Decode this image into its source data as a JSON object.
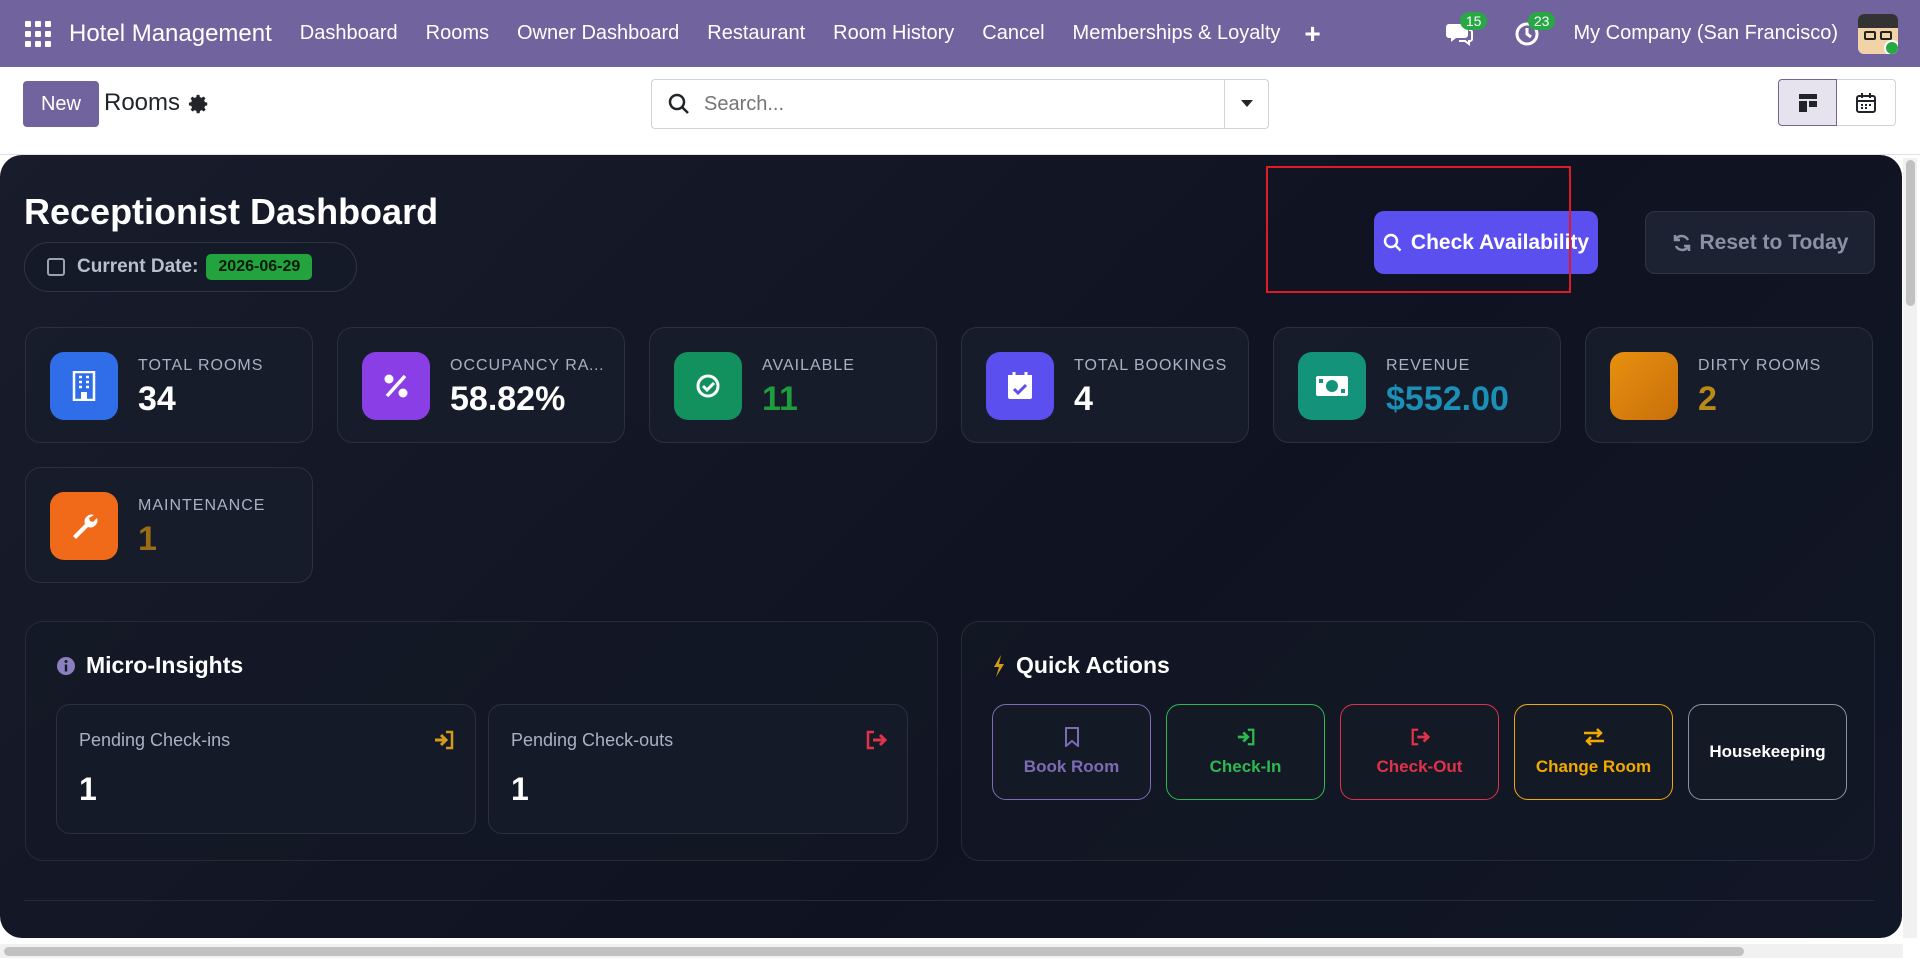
{
  "app": {
    "brand": "Hotel Management"
  },
  "nav": {
    "items": [
      "Dashboard",
      "Rooms",
      "Owner Dashboard",
      "Restaurant",
      "Room History",
      "Cancel",
      "Memberships & Loyalty"
    ],
    "plus_icon": "plus-icon",
    "messages_count": "15",
    "activities_count": "23",
    "company": "My Company (San Francisco)"
  },
  "control": {
    "new_label": "New",
    "breadcrumb": "Rooms",
    "search_placeholder": "Search..."
  },
  "dashboard": {
    "title": "Receptionist Dashboard",
    "date_label": "Current Date:",
    "date_value": "2026-06-29",
    "check_btn": "Check Availability",
    "reset_btn": "Reset to Today",
    "stats": [
      {
        "label": "TOTAL ROOMS",
        "value": "34",
        "icon": "building-icon",
        "color": "#ffffff",
        "bg": "#2f6ee8"
      },
      {
        "label": "OCCUPANCY RATE",
        "value": "58.82%",
        "icon": "percent-icon",
        "color": "#ffffff",
        "bg": "#8a3fe6"
      },
      {
        "label": "AVAILABLE",
        "value": "11",
        "icon": "check-circle-icon",
        "color": "#1f9d3c",
        "bg": "#12915f"
      },
      {
        "label": "TOTAL BOOKINGS",
        "value": "4",
        "icon": "calendar-check-icon",
        "color": "#ffffff",
        "bg": "#5b4ff0"
      },
      {
        "label": "REVENUE",
        "value": "$552.00",
        "icon": "money-icon",
        "color": "#1b8fb5",
        "bg": "#12937a"
      },
      {
        "label": "DIRTY ROOMS",
        "value": "2",
        "icon": "dirty-icon",
        "color": "#b98a18",
        "bg": "#e08a12"
      },
      {
        "label": "MAINTENANCE",
        "value": "1",
        "icon": "wrench-icon",
        "color": "#9a6d14",
        "bg": "#f06a1a"
      }
    ],
    "insights": {
      "title": "Micro-Insights",
      "pending_checkins_label": "Pending Check-ins",
      "pending_checkins_value": "1",
      "pending_checkouts_label": "Pending Check-outs",
      "pending_checkouts_value": "1"
    },
    "quick_actions": {
      "title": "Quick Actions",
      "items": [
        {
          "label": "Book Room",
          "color": "#7c6bb5",
          "icon": "bookmark-icon"
        },
        {
          "label": "Check-In",
          "color": "#2eb84e",
          "icon": "sign-in-icon"
        },
        {
          "label": "Check-Out",
          "color": "#e0324a",
          "icon": "sign-out-icon"
        },
        {
          "label": "Change Room",
          "color": "#f2a900",
          "icon": "exchange-icon"
        },
        {
          "label": "Housekeeping",
          "color": "#ffffff",
          "icon": ""
        }
      ]
    }
  }
}
